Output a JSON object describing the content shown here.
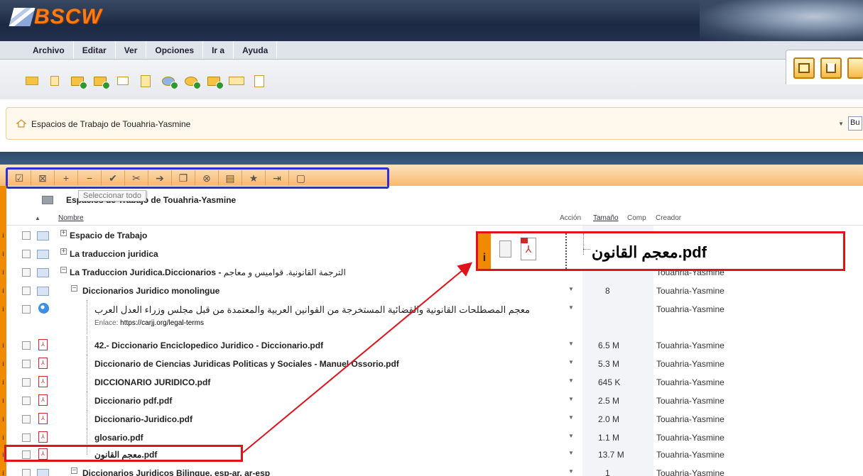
{
  "app": {
    "logo": "BSCW"
  },
  "menu": [
    "Archivo",
    "Editar",
    "Ver",
    "Opciones",
    "Ir a",
    "Ayuda"
  ],
  "breadcrumb": {
    "text": "Espacios de Trabajo de Touahria-Yasmine",
    "select_value": "Bu"
  },
  "tooltip": "Seleccionar todo",
  "path": {
    "title": "Espacios de Trabajo de Touahria-Yasmine"
  },
  "columns": {
    "name": "Nombre",
    "accion": "Acción",
    "tamano": "Tamaño",
    "comp": "Comp",
    "creador": "Creador"
  },
  "rows": [
    {
      "name": "Espacio de Trabajo",
      "size": "",
      "creator": ""
    },
    {
      "name": "La traduccion juridica",
      "size": "",
      "creator": ""
    },
    {
      "name": "La Traduccion Juridica.Diccionarios -",
      "name_ar": "الترجمة القانونية. قواميس و معاجم",
      "size": "",
      "creator": "Touahria-Yasmine"
    },
    {
      "name": "Diccionarios Juridico monolingue",
      "size": "8",
      "creator": "Touahria-Yasmine"
    },
    {
      "name": "معجم المصطلحات القانونية والقضائية المستخرجة من القوانين العربية والمعتمدة من قبل مجلس وزراء العدل العرب",
      "link_label": "Enlace:",
      "link": "https://carjj.org/legal-terms",
      "size": "",
      "creator": "Touahria-Yasmine"
    },
    {
      "name": "42.- Diccionario Enciclopedico Juridico - Diccionario.pdf",
      "size": "6.5 M",
      "creator": "Touahria-Yasmine"
    },
    {
      "name": "Diccionario de Ciencias Juridicas Politicas y Sociales - Manuel Ossorio.pdf",
      "size": "5.3 M",
      "creator": "Touahria-Yasmine"
    },
    {
      "name": "DICCIONARIO JURIDICO.pdf",
      "size": "645 K",
      "creator": "Touahria-Yasmine"
    },
    {
      "name": "Diccionario pdf.pdf",
      "size": "2.5 M",
      "creator": "Touahria-Yasmine"
    },
    {
      "name": "Diccionario-Juridico.pdf",
      "size": "2.0 M",
      "creator": "Touahria-Yasmine"
    },
    {
      "name": "glosario.pdf",
      "size": "1.1 M",
      "creator": "Touahria-Yasmine"
    },
    {
      "name": "معجم القانون.pdf",
      "size": "13.7 M",
      "creator": "Touahria-Yasmine"
    },
    {
      "name": "Diccionarios Juridicos Bilingue. esp-ar, ar-esp",
      "size": "1",
      "creator": "Touahria-Yasmine"
    }
  ],
  "popup": {
    "name": "معجم القانون.pdf"
  },
  "colors": {
    "annotation": "#e0121a",
    "selection_box": "#3030d0",
    "accent": "#f08a00"
  }
}
